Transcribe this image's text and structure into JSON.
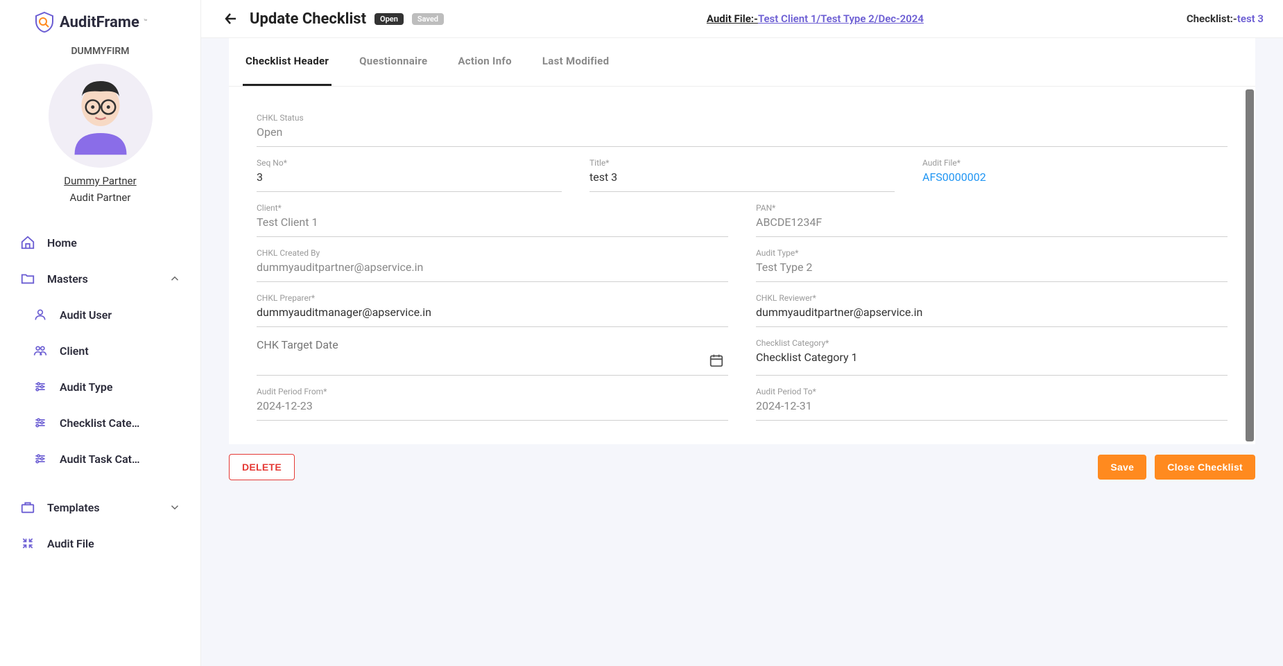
{
  "logo": {
    "text": "AuditFrame"
  },
  "firm": "DUMMYFIRM",
  "user": {
    "name": "Dummy Partner",
    "role": "Audit Partner"
  },
  "nav": {
    "home": "Home",
    "masters": "Masters",
    "audit_user": "Audit User",
    "client": "Client",
    "audit_type": "Audit Type",
    "checklist_cat": "Checklist Cate…",
    "audit_task_cat": "Audit Task Cat…",
    "templates": "Templates",
    "audit_file": "Audit File"
  },
  "header": {
    "title": "Update Checklist",
    "badge_open": "Open",
    "badge_saved": "Saved",
    "breadcrumb_prefix": "Audit File:-",
    "breadcrumb_link": "Test Client 1/Test Type 2/Dec-2024",
    "right_label": "Checklist:-",
    "right_value": "test 3"
  },
  "tabs": {
    "checklist_header": "Checklist Header",
    "questionnaire": "Questionnaire",
    "action_info": "Action Info",
    "last_modified": "Last Modified"
  },
  "form": {
    "chkl_status_label": "CHKL Status",
    "chkl_status": "Open",
    "seq_no_label": "Seq No*",
    "seq_no": "3",
    "title_label": "Title*",
    "title": "test 3",
    "audit_file_label": "Audit File*",
    "audit_file": "AFS0000002",
    "client_label": "Client*",
    "client": "Test Client 1",
    "pan_label": "PAN*",
    "pan": "ABCDE1234F",
    "chkl_created_by_label": "CHKL Created By",
    "chkl_created_by": "dummyauditpartner@apservice.in",
    "audit_type_label": "Audit Type*",
    "audit_type": "Test Type 2",
    "chkl_preparer_label": "CHKL Preparer*",
    "chkl_preparer": "dummyauditmanager@apservice.in",
    "chkl_reviewer_label": "CHKL Reviewer*",
    "chkl_reviewer": "dummyauditpartner@apservice.in",
    "chk_target_date_label": "CHK Target Date",
    "chk_target_date": "",
    "checklist_category_label": "Checklist Category*",
    "checklist_category": "Checklist Category 1",
    "audit_period_from_label": "Audit Period From*",
    "audit_period_from": "2024-12-23",
    "audit_period_to_label": "Audit Period To*",
    "audit_period_to": "2024-12-31"
  },
  "actions": {
    "delete": "DELETE",
    "save": "Save",
    "close": "Close Checklist"
  }
}
